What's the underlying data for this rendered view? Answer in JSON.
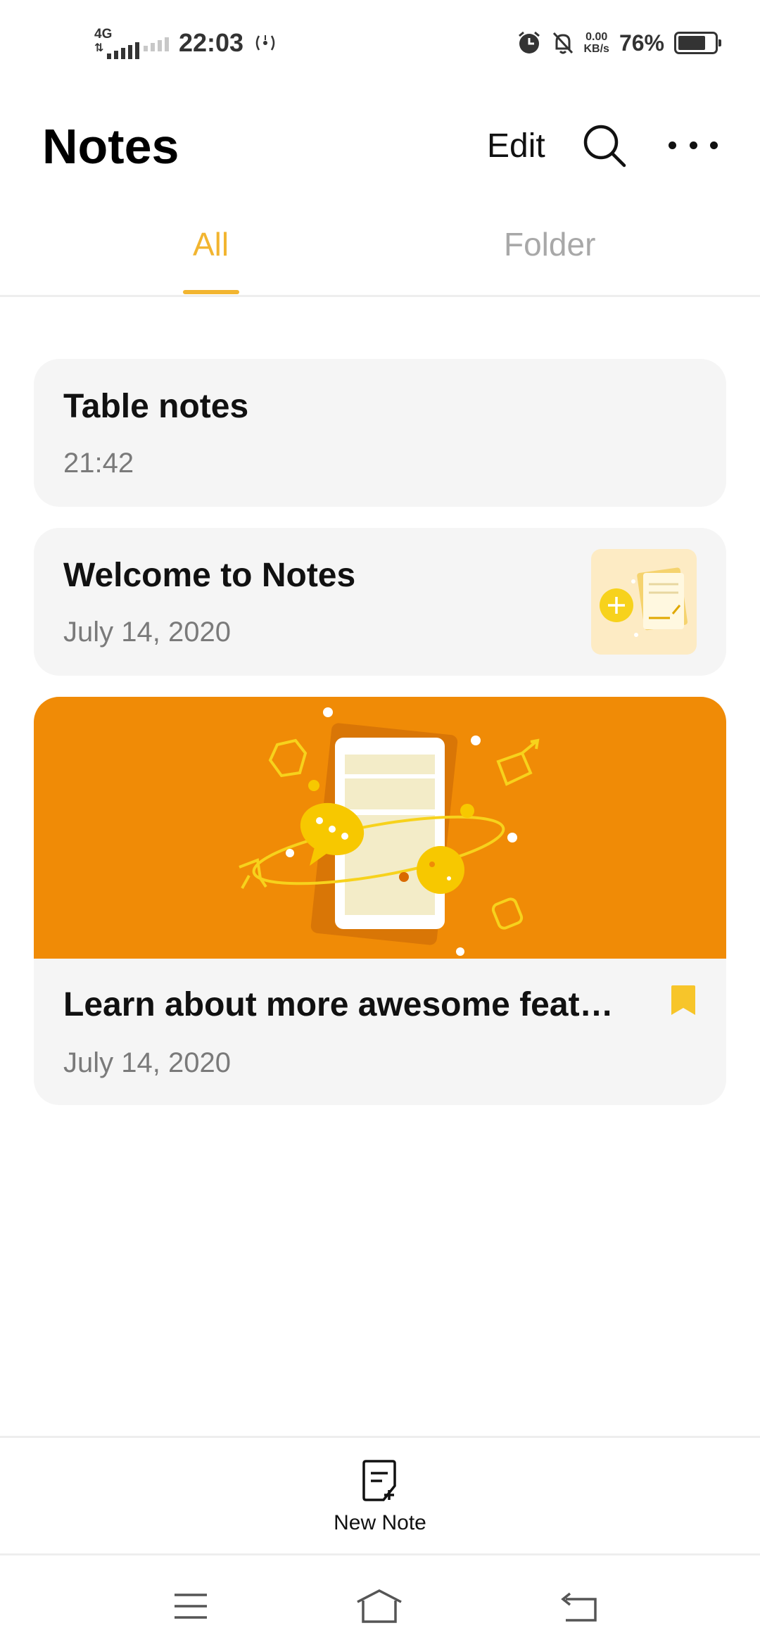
{
  "status_bar": {
    "network": "4G",
    "time": "22:03",
    "speed_value": "0.00",
    "speed_unit": "KB/s",
    "battery": "76%",
    "battery_level": 0.76
  },
  "header": {
    "title": "Notes",
    "edit_label": "Edit"
  },
  "tabs": [
    {
      "label": "All",
      "active": true
    },
    {
      "label": "Folder",
      "active": false
    }
  ],
  "notes": [
    {
      "title": "Table notes",
      "date": "21:42"
    },
    {
      "title": "Welcome to Notes",
      "date": "July 14, 2020"
    },
    {
      "title": "Learn about more awesome feat…",
      "date": "July 14, 2020"
    }
  ],
  "bottom_bar": {
    "new_note_label": "New Note"
  },
  "colors": {
    "accent": "#f2b530",
    "banner": "#f08b06",
    "card_bg": "#f5f5f5",
    "bookmark": "#f7c52a"
  },
  "icons": [
    "search-icon",
    "more-icon",
    "new-note-icon",
    "bookmark-icon",
    "menu-icon",
    "home-icon",
    "back-icon",
    "alarm-icon",
    "mute-icon",
    "battery-icon",
    "hotspot-icon",
    "signal-icon"
  ]
}
